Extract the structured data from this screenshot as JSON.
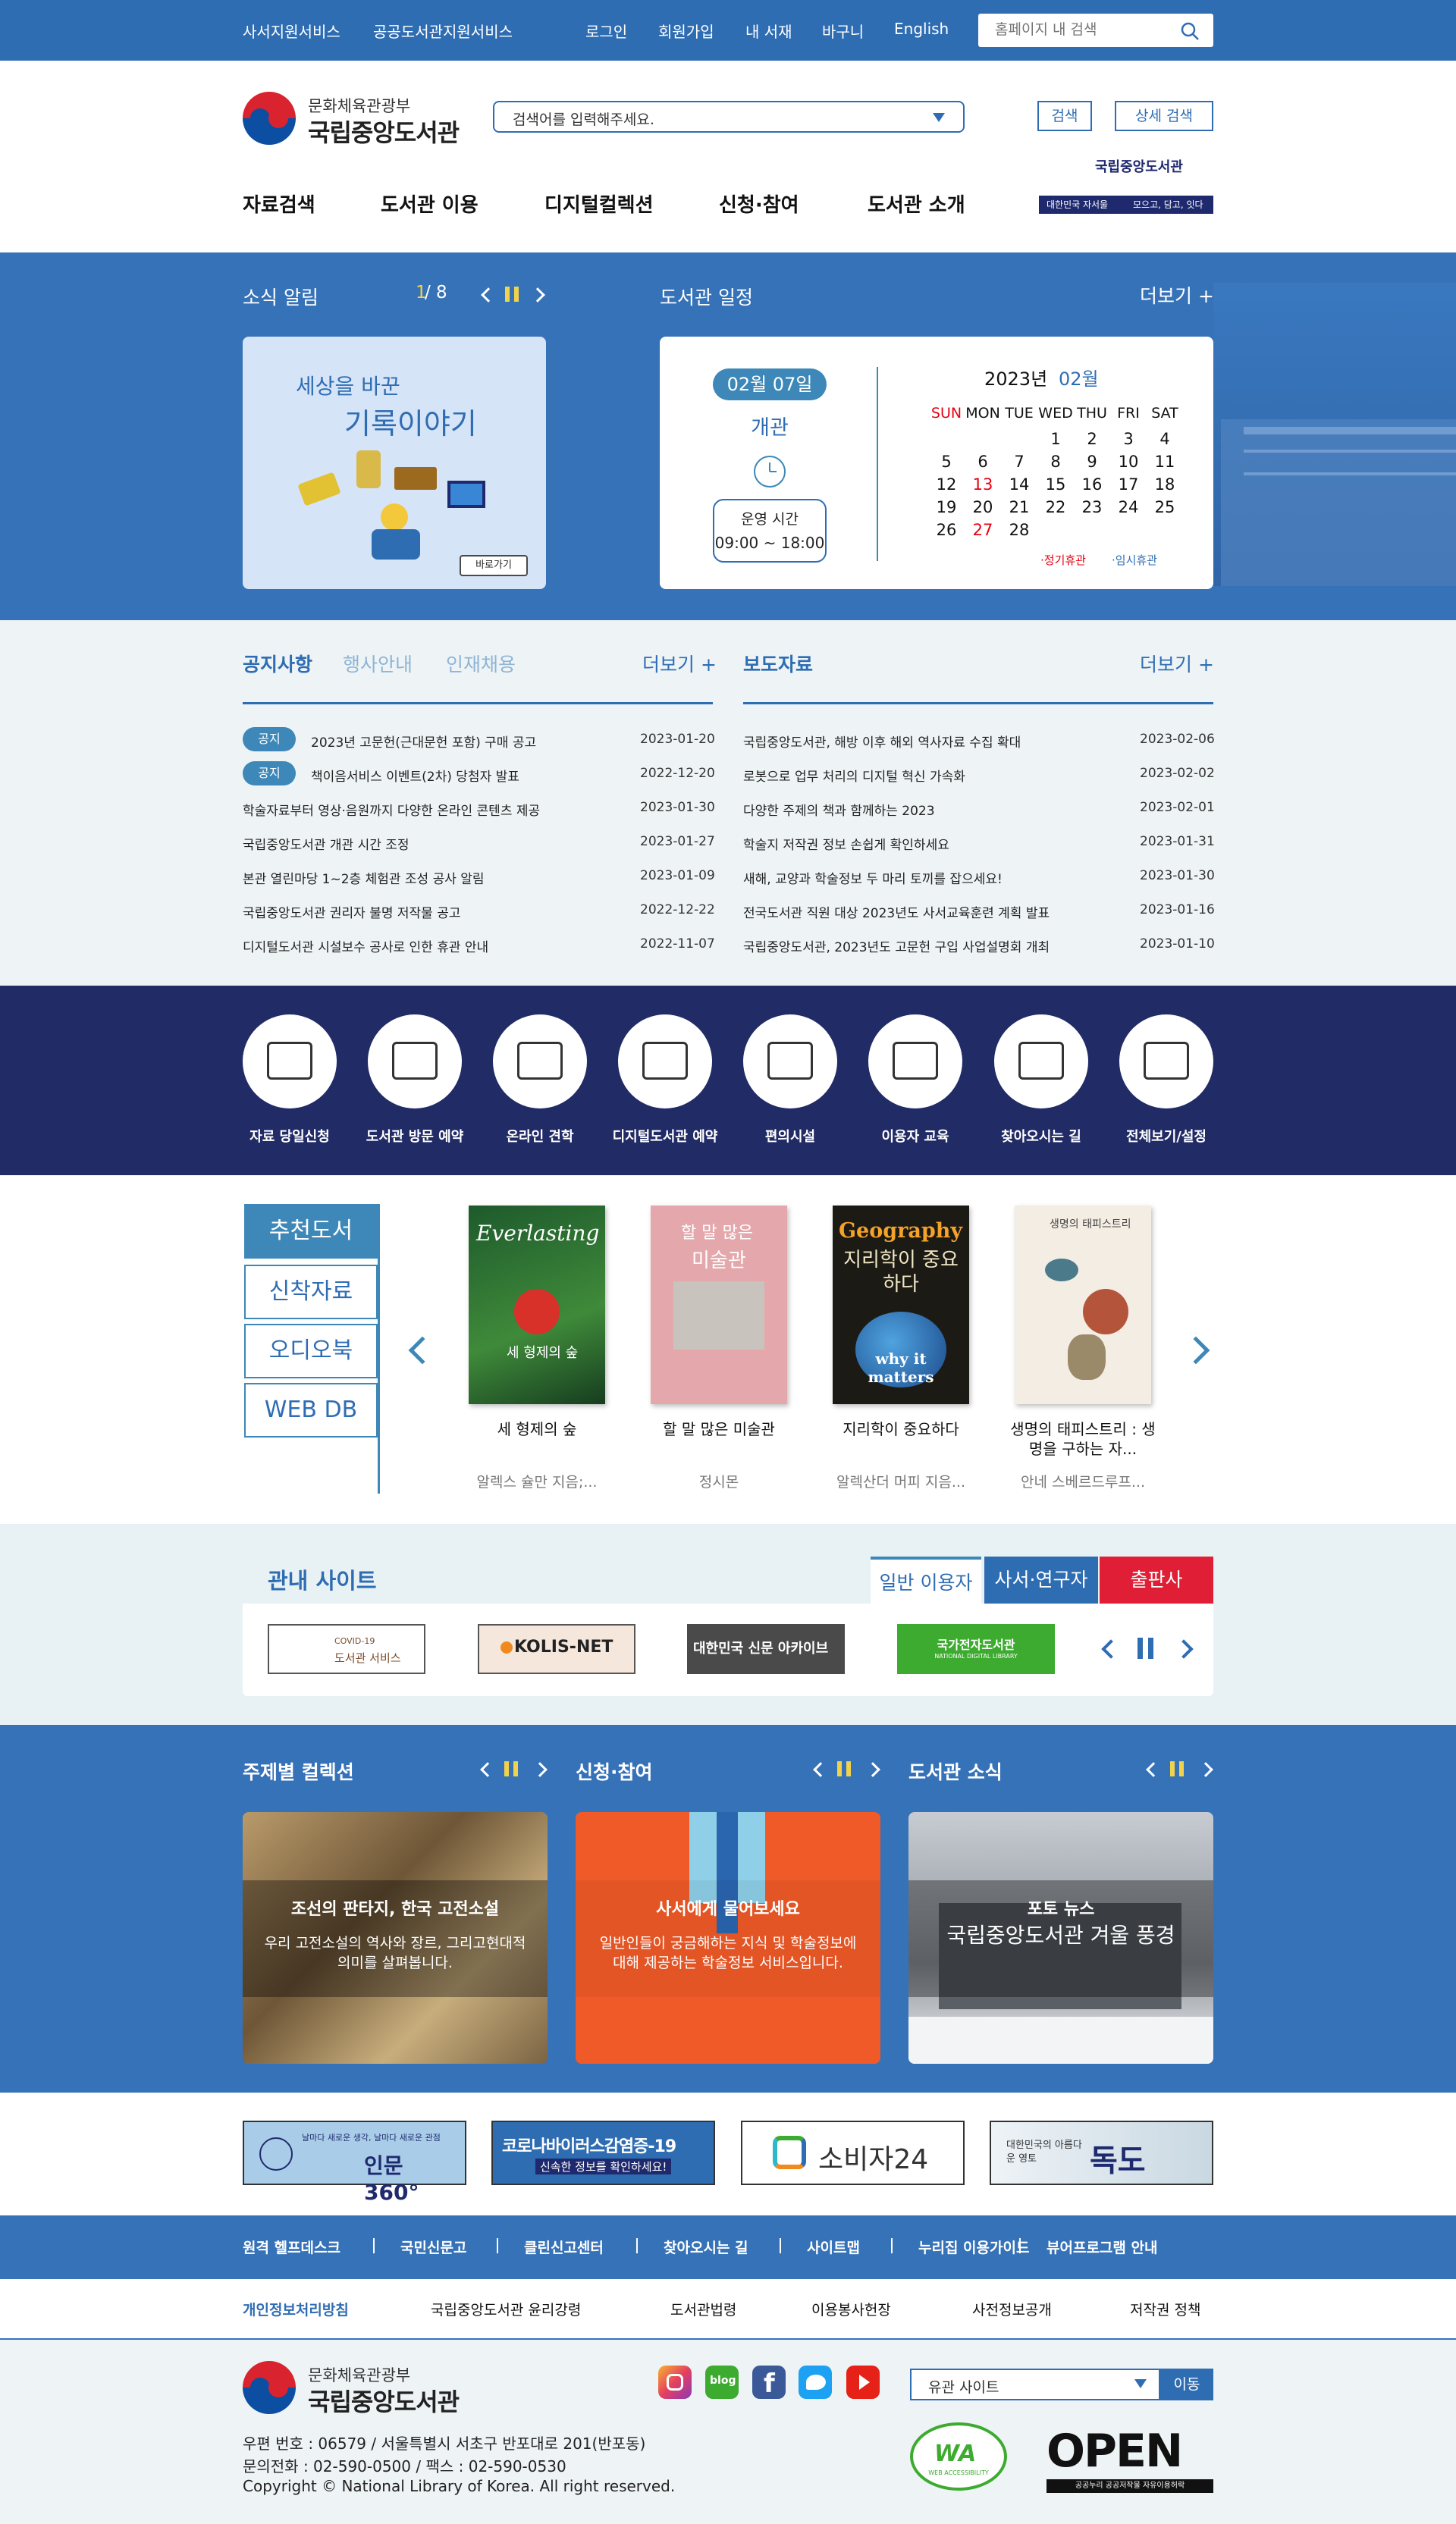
{
  "topbar": {
    "links": [
      "사서지원서비스",
      "공공도서관지원서비스"
    ],
    "util": [
      "로그인",
      "회원가입",
      "내 서재",
      "바구니",
      "English"
    ],
    "search_placeholder": "홈페이지 내 검색"
  },
  "header": {
    "logo_sub": "문화체육관광부",
    "logo_main": "국립중앙도서관",
    "search_placeholder": "검색어를 입력해주세요.",
    "search_btn": "검색",
    "detail_btn": "상세 검색",
    "banner_label1": "대한민국 자서울",
    "banner_label2": "모으고, 담고, 잇다",
    "banner_logo": "국립중앙도서관"
  },
  "gnb": [
    "자료검색",
    "도서관 이용",
    "디지털컬렉션",
    "신청·참여",
    "도서관 소개"
  ],
  "news": {
    "title": "소식 알림",
    "page_cur": "1",
    "page_total": " / 8",
    "card_line1": "세상을 바꾼",
    "card_line2": "기록이야기",
    "card_btn": "바로가기"
  },
  "schedule": {
    "title": "도서관 일정",
    "more": "더보기 +",
    "date": "02월 07일",
    "status": "개관",
    "hours_label": "운영 시간",
    "hours": "09:00 ~ 18:00",
    "year": "2023년",
    "month": "02월",
    "weekdays": [
      "SUN",
      "MON",
      "TUE",
      "WED",
      "THU",
      "FRI",
      "SAT"
    ],
    "days": [
      [
        "",
        "",
        "",
        "1",
        "2",
        "3",
        "4"
      ],
      [
        "5",
        "6",
        "7",
        "8",
        "9",
        "10",
        "11"
      ],
      [
        "12",
        "13",
        "14",
        "15",
        "16",
        "17",
        "18"
      ],
      [
        "19",
        "20",
        "21",
        "22",
        "23",
        "24",
        "25"
      ],
      [
        "26",
        "27",
        "28",
        "",
        "",
        "",
        ""
      ]
    ],
    "legend_regular": "·정기휴관",
    "legend_temp": "·임시휴관",
    "colors": {
      "closed": "#e60012",
      "temp": "#2f6db3"
    }
  },
  "notice": {
    "tabs": [
      "공지사항",
      "행사안내",
      "인재채용"
    ],
    "more": "더보기 +",
    "badge": "공지",
    "items": [
      {
        "t": "2023년 고문헌(근대문헌 포함) 구매 공고",
        "d": "2023-01-20"
      },
      {
        "t": "책이음서비스 이벤트(2차) 당첨자 발표",
        "d": "2022-12-20"
      },
      {
        "t": "학술자료부터 영상·음원까지 다양한 온라인 콘텐츠 제공",
        "d": "2023-01-30"
      },
      {
        "t": "국립중앙도서관 개관 시간 조정",
        "d": "2023-01-27"
      },
      {
        "t": "본관 열린마당 1~2층 체험관 조성 공사 알림",
        "d": "2023-01-09"
      },
      {
        "t": "국립중앙도서관 권리자 불명 저작물 공고",
        "d": "2022-12-22"
      },
      {
        "t": "디지털도서관 시설보수 공사로 인한 휴관 안내",
        "d": "2022-11-07"
      }
    ]
  },
  "press": {
    "title": "보도자료",
    "more": "더보기 +",
    "items": [
      {
        "t": "국립중앙도서관, 해방 이후 해외 역사자료 수집 확대",
        "d": "2023-02-06"
      },
      {
        "t": "로봇으로 업무 처리의 디지털 혁신 가속화",
        "d": "2023-02-02"
      },
      {
        "t": "다양한 주제의 책과 함께하는 2023",
        "d": "2023-02-01"
      },
      {
        "t": "학술지 저작권 정보 손쉽게 확인하세요",
        "d": "2023-01-31"
      },
      {
        "t": "새해, 교양과 학술정보 두 마리 토끼를 잡으세요!",
        "d": "2023-01-30"
      },
      {
        "t": "전국도서관 직원 대상 2023년도 사서교육훈련 계획 발표",
        "d": "2023-01-16"
      },
      {
        "t": "국립중앙도서관, 2023년도 고문헌 구입 사업설명회 개최",
        "d": "2023-01-10"
      }
    ]
  },
  "quick": [
    "자료 당일신청",
    "도서관 방문 예약",
    "온라인 견학",
    "디지털도서관 예약",
    "편의시설",
    "이용자 교육",
    "찾아오시는 길",
    "전체보기/설정"
  ],
  "books": {
    "tabs": [
      "추천도서",
      "신착자료",
      "오디오북",
      "WEB DB"
    ],
    "items": [
      {
        "t": "세 형제의 숲",
        "a": "알렉스 슐만 지음;..."
      },
      {
        "t": "할 말 많은 미술관",
        "a": "정시몬"
      },
      {
        "t": "지리학이 중요하다",
        "a": "알렉산더 머피 지음..."
      },
      {
        "t": "생명의 태피스트리 : 생명을 구하는 자...",
        "a": "안네 스베르드루프..."
      }
    ],
    "cover1_top": "Everlasting",
    "cover1_sub": "세 형제의 숲",
    "cover2_top": "할 말 많은",
    "cover2_sub": "미술관",
    "cover3_top": "Geography",
    "cover3_mid": "지리학이 중요하다",
    "cover3_bot": "why it matters",
    "cover4_top": "생명의 태피스트리"
  },
  "sites": {
    "title": "관내 사이트",
    "tabs": [
      "일반 이용자",
      "사서·연구자",
      "출판사"
    ],
    "logos": [
      {
        "l1": "COVID-19",
        "l2": "도서관 서비스"
      },
      {
        "l1": "KOLIS-NET"
      },
      {
        "l1": "대한민국 신문 아카이브"
      },
      {
        "l1": "국가전자도서관",
        "l2": "NATIONAL DIGITAL LIBRARY"
      }
    ]
  },
  "collections": [
    {
      "title": "주제별 컬렉션",
      "head": "조선의 판타지, 한국 고전소설",
      "body": "우리 고전소설의 역사와 장르, 그리고현대적 의미를 살펴봅니다."
    },
    {
      "title": "신청·참여",
      "head": "사서에게 물어보세요",
      "body": "일반인들이 궁금해하는 지식 및 학술정보에 대해 제공하는 학술정보 서비스입니다."
    },
    {
      "title": "도서관 소식",
      "head": "포토 뉴스",
      "body": "국립중앙도서관 겨울 풍경"
    }
  ],
  "banners": [
    {
      "l1": "날마다 새로운 생각, 날마다 새로운 관점",
      "l2": "인문 360°"
    },
    {
      "l1": "코로나바이러스감염증-19",
      "l2": "신속한 정보를 확인하세요!"
    },
    {
      "l1": "소비자24"
    },
    {
      "l1": "대한민국의 아름다운 영토",
      "l2": "독도"
    }
  ],
  "footer": {
    "links": [
      "원격 헬프데스크",
      "국민신문고",
      "클린신고센터",
      "찾아오시는 길",
      "사이트맵",
      "누리집 이용가이드",
      "뷰어프로그램 안내"
    ],
    "links2": [
      "개인정보처리방침",
      "국립중앙도서관 윤리강령",
      "도서관법령",
      "이용봉사헌장",
      "사전정보공개",
      "저작권 정책"
    ],
    "select": "유관 사이트",
    "go": "이동",
    "sns": [
      "instagram",
      "blog",
      "facebook",
      "twitter",
      "youtube"
    ],
    "address": "우편 번호 : 06579 / 서울특별시 서초구 반포대로 201(반포동)",
    "phone": "문의전화 : 02-590-0500 / 팩스 : 02-590-0530",
    "copy": "Copyright © National Library of Korea. All right reserved.",
    "wa_label": "WA",
    "wa_sub": "WEB ACCESSIBILITY",
    "open_label": "OPEN",
    "open_sub": "공공누리 공공저작물 자유이용허락"
  }
}
